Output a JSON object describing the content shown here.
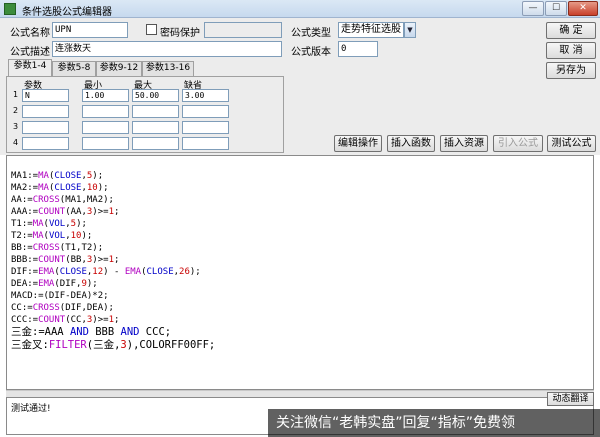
{
  "window": {
    "title": "条件选股公式编辑器",
    "controls": {
      "minimize": "—",
      "maximize": "☐",
      "close": "✕"
    }
  },
  "form": {
    "name_label": "公式名称",
    "name_value": "UPN",
    "password_label": "密码保护",
    "password_checked": false,
    "description_label": "公式描述",
    "description_value": "连涨数天",
    "type_label": "公式类型",
    "type_value": "走势特征选股",
    "version_label": "公式版本",
    "version_value": "0"
  },
  "buttons": {
    "confirm": "确  定",
    "cancel": "取  消",
    "save_as": "另存为",
    "edit_ops": "编辑操作",
    "insert_func": "插入函数",
    "insert_resource": "插入资源",
    "import_formula": "引入公式",
    "test_formula": "测试公式"
  },
  "tabs": [
    "参数1-4",
    "参数5-8",
    "参数9-12",
    "参数13-16"
  ],
  "params": {
    "headers": [
      "参数",
      "最小",
      "最大",
      "缺省"
    ],
    "rows": [
      {
        "num": "1",
        "name": "N",
        "min": "1.00",
        "max": "50.00",
        "default": "3.00"
      },
      {
        "num": "2",
        "name": "",
        "min": "",
        "max": "",
        "default": ""
      },
      {
        "num": "3",
        "name": "",
        "min": "",
        "max": "",
        "default": ""
      },
      {
        "num": "4",
        "name": "",
        "min": "",
        "max": "",
        "default": ""
      }
    ]
  },
  "code_lines": [
    "MA1:=MA(CLOSE,5);",
    "MA2:=MA(CLOSE,10);",
    "AA:=CROSS(MA1,MA2);",
    "AAA:=COUNT(AA,3)>=1;",
    "T1:=MA(VOL,5);",
    "T2:=MA(VOL,10);",
    "BB:=CROSS(T1,T2);",
    "BBB:=COUNT(BB,3)>=1;",
    "DIF:=EMA(CLOSE,12) - EMA(CLOSE,26);",
    "DEA:=EMA(DIF,9);",
    "MACD:=(DIF-DEA)*2;",
    "CC:=CROSS(DIF,DEA);",
    "CCC:=COUNT(CC,3)>=1;",
    "三金:=AAA AND BBB AND CCC;",
    "三金叉:FILTER(三金,3),COLORFF00FF;"
  ],
  "status": {
    "message": "测试通过!",
    "dynamic_translate": "动态翻译"
  },
  "watermark": "关注微信“老韩实盘”回复“指标”免费领"
}
